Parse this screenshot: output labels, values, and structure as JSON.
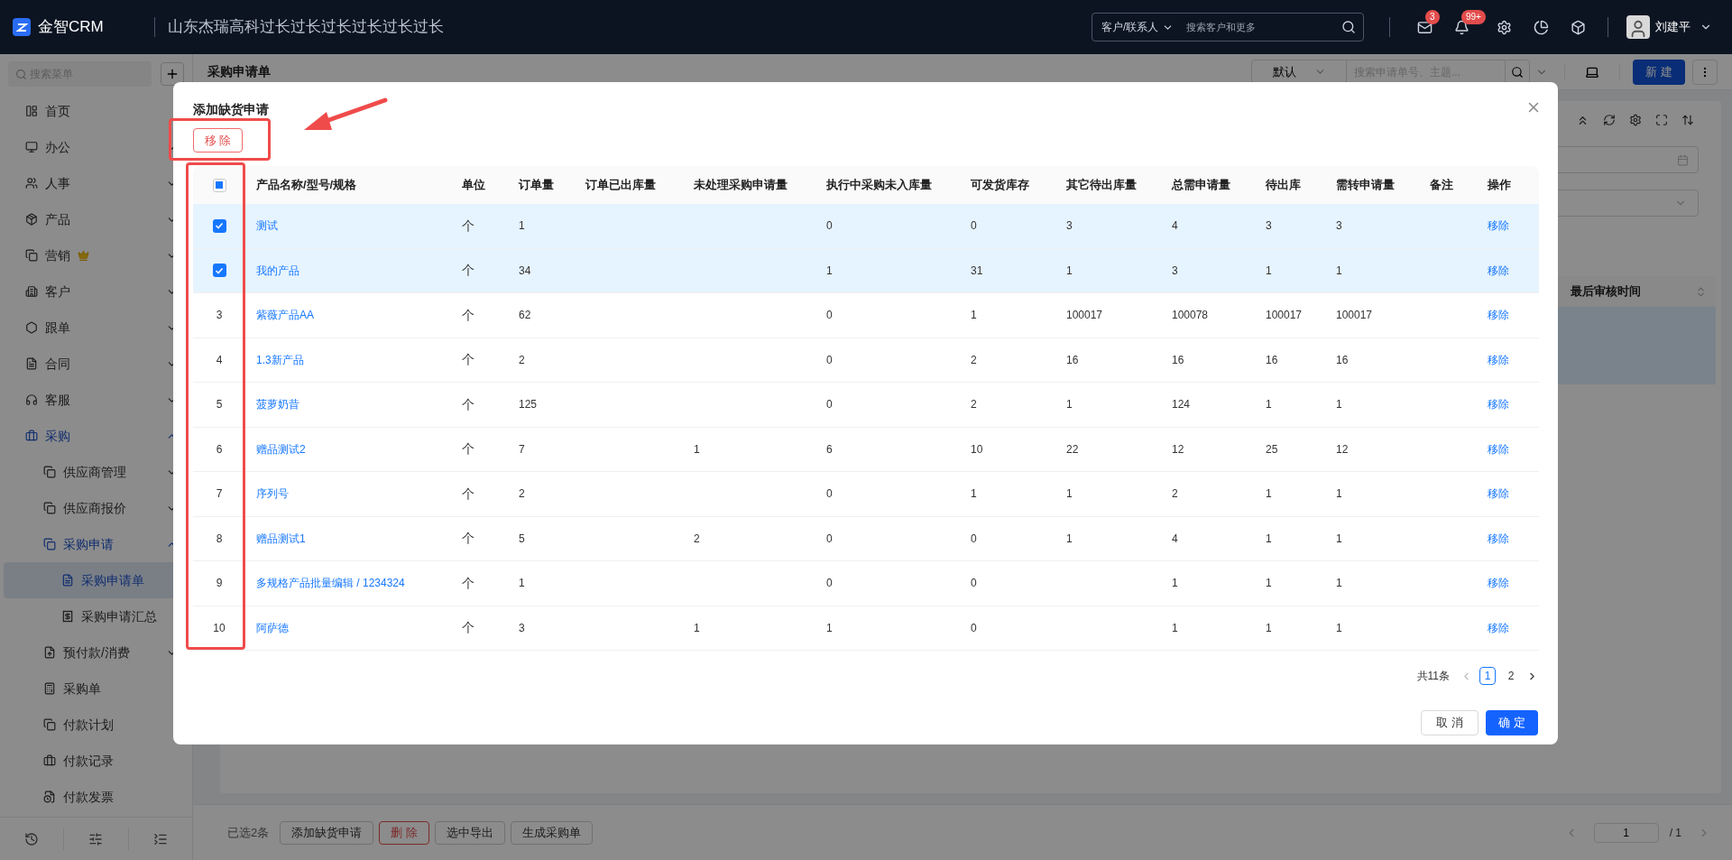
{
  "top_bar": {
    "logo": "金智CRM",
    "company": "山东杰瑞高科过长过长过长过长过长过长",
    "search_scope": "客户/联系人",
    "search_placeholder": "搜索客户和更多",
    "badges": [
      "3",
      "99+"
    ],
    "user_name": "刘建平"
  },
  "sidebar": {
    "search_placeholder": "搜索菜单",
    "items": [
      {
        "label": "首页",
        "kind": "link",
        "selected": false
      },
      {
        "label": "办公",
        "kind": "group",
        "expanded": false,
        "selected": false
      },
      {
        "label": "人事",
        "kind": "group",
        "expanded": false,
        "selected": false
      },
      {
        "label": "产品",
        "kind": "group",
        "expanded": false,
        "selected": false
      },
      {
        "label": "营销",
        "kind": "group",
        "expanded": false,
        "selected": false,
        "crown": true
      },
      {
        "label": "客户",
        "kind": "group",
        "expanded": false,
        "selected": false
      },
      {
        "label": "跟单",
        "kind": "group",
        "expanded": false,
        "selected": false
      },
      {
        "label": "合同",
        "kind": "group",
        "expanded": false,
        "selected": false
      },
      {
        "label": "客服",
        "kind": "group",
        "expanded": false,
        "selected": false
      },
      {
        "label": "采购",
        "kind": "group",
        "expanded": true,
        "selected": false,
        "children": [
          {
            "label": "供应商管理",
            "kind": "group",
            "expanded": false,
            "selected": false
          },
          {
            "label": "供应商报价",
            "kind": "group",
            "expanded": false,
            "selected": false
          },
          {
            "label": "采购申请",
            "kind": "group",
            "expanded": true,
            "selected": false,
            "children": [
              {
                "label": "采购申请单",
                "kind": "link",
                "selected": true
              },
              {
                "label": "采购申请汇总",
                "kind": "link",
                "selected": false
              }
            ]
          },
          {
            "label": "预付款/消费",
            "kind": "group",
            "expanded": false,
            "selected": false
          },
          {
            "label": "采购单",
            "kind": "link",
            "selected": false
          },
          {
            "label": "付款计划",
            "kind": "link",
            "selected": false
          },
          {
            "label": "付款记录",
            "kind": "link",
            "selected": false
          },
          {
            "label": "付款发票",
            "kind": "link",
            "selected": false
          }
        ]
      }
    ]
  },
  "page": {
    "title": "采购申请单",
    "view_select": "默认",
    "search_placeholder": "搜索申请单号、主题...",
    "new_button": "新 建",
    "table_header": "最后审核时间",
    "selected_count": "已选2条",
    "actions": [
      "添加缺货申请",
      "删 除",
      "选中导出",
      "生成采购单"
    ],
    "page_input": "1",
    "page_total": "/ 1"
  },
  "modal": {
    "title": "添加缺货申请",
    "remove_button": "移 除",
    "select_all": {
      "indeterminate": true
    },
    "columns": [
      "产品名称/型号/规格",
      "单位",
      "订单量",
      "订单已出库量",
      "未处理采购申请量",
      "执行中采购未入库量",
      "可发货库存",
      "其它待出库量",
      "总需申请量",
      "待出库",
      "需转申请量",
      "备注",
      "操作"
    ],
    "rows": [
      {
        "selected": true,
        "cells": [
          "测试",
          "个",
          "1",
          null,
          null,
          "0",
          "0",
          "3",
          "4",
          "3",
          "3",
          null
        ],
        "action": "移除"
      },
      {
        "selected": true,
        "cells": [
          "我的产品",
          "个",
          "34",
          null,
          null,
          "1",
          "31",
          "1",
          "3",
          "1",
          "1",
          null
        ],
        "action": "移除"
      },
      {
        "selected": false,
        "number": "3",
        "cells": [
          "紫薇产品AA",
          "个",
          "62",
          null,
          null,
          "0",
          "1",
          "100017",
          "100078",
          "100017",
          "100017",
          null
        ],
        "action": "移除"
      },
      {
        "selected": false,
        "number": "4",
        "cells": [
          "1.3新产品",
          "个",
          "2",
          null,
          null,
          "0",
          "2",
          "16",
          "16",
          "16",
          "16",
          null
        ],
        "action": "移除"
      },
      {
        "selected": false,
        "number": "5",
        "cells": [
          "菠萝奶昔",
          "个",
          "125",
          null,
          null,
          "0",
          "2",
          "1",
          "124",
          "1",
          "1",
          null
        ],
        "action": "移除"
      },
      {
        "selected": false,
        "number": "6",
        "cells": [
          "赠品测试2",
          "个",
          "7",
          null,
          "1",
          "6",
          "10",
          "22",
          "12",
          "25",
          "12",
          null
        ],
        "action": "移除"
      },
      {
        "selected": false,
        "number": "7",
        "cells": [
          "序列号",
          "个",
          "2",
          null,
          null,
          "0",
          "1",
          "1",
          "2",
          "1",
          "1",
          null
        ],
        "action": "移除"
      },
      {
        "selected": false,
        "number": "8",
        "cells": [
          "赠品测试1",
          "个",
          "5",
          null,
          "2",
          "0",
          "0",
          "1",
          "4",
          "1",
          "1",
          null
        ],
        "action": "移除"
      },
      {
        "selected": false,
        "number": "9",
        "cells": [
          "多规格产品批量编辑 / 1234324",
          "个",
          "1",
          null,
          null,
          "0",
          "0",
          null,
          "1",
          "1",
          "1",
          null
        ],
        "action": "移除"
      },
      {
        "selected": false,
        "number": "10",
        "cells": [
          "阿萨德",
          "个",
          "3",
          null,
          "1",
          "1",
          "0",
          null,
          "1",
          "1",
          "1",
          null
        ],
        "action": "移除"
      }
    ],
    "total": "共11条",
    "pages": [
      {
        "label": "1",
        "selected": true
      },
      {
        "label": "2",
        "selected": false
      }
    ],
    "cancel": "取 消",
    "ok": "确 定"
  }
}
